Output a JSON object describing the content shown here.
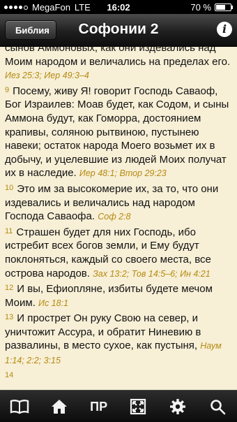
{
  "status": {
    "carrier": "MegaFon",
    "network": "LTE",
    "time": "16:02",
    "battery": "70 %",
    "battery_level": 0.7
  },
  "nav": {
    "back_label": "Библия",
    "title": "Софонии 2",
    "info_icon": "info-icon"
  },
  "verses": [
    {
      "num": "",
      "text": "сынов Аммоновых, как они издевались над Моим народом и величались на пределах его.",
      "refs": "Иез 25:3; Иер 49:3–4"
    },
    {
      "num": "9",
      "text": "Посему, живу Я! говорит Господь Саваоф, Бог Израилев: Моав будет, как Содом, и сыны Аммона будут, как Гоморра, достоянием крапивы, соляною рытвиною, пустынею навеки; остаток народа Моего возьмет их в добычу, и уцелевшие из людей Моих получат их в наследие.",
      "refs": "Иер 48:1; Втор 29:23"
    },
    {
      "num": "10",
      "text": "Это им за высокомерие их, за то, что они издевались и величались над народом Господа Саваофа.",
      "refs": "Соф 2:8"
    },
    {
      "num": "11",
      "text": "Страшен будет для них Господь, ибо истребит всех богов земли, и Ему будут поклоняться, каждый со своего места, все острова народов.",
      "refs": "Зах 13:2; Тов 14:5–6; Ин 4:21"
    },
    {
      "num": "12",
      "text": "И вы, Ефиопляне, избиты будете мечом Моим.",
      "refs": "Ис 18:1"
    },
    {
      "num": "13",
      "text": "И прострет Он руку Свою на север, и уничтожит Ассура, и обратит Ниневию в развалины, в место сухое, как пустыня,",
      "refs": "Наум 1:14; 2:2; 3:15"
    },
    {
      "num": "14",
      "text": "",
      "refs": ""
    }
  ],
  "tabbar": {
    "book_icon": "book-icon",
    "home_icon": "home-icon",
    "pr_label": "ПР",
    "fullscreen_icon": "fullscreen-icon",
    "settings_icon": "gear-icon",
    "search_icon": "search-icon"
  },
  "colors": {
    "background": "#f7efd6",
    "reference": "#b58a12",
    "text": "#111111"
  }
}
